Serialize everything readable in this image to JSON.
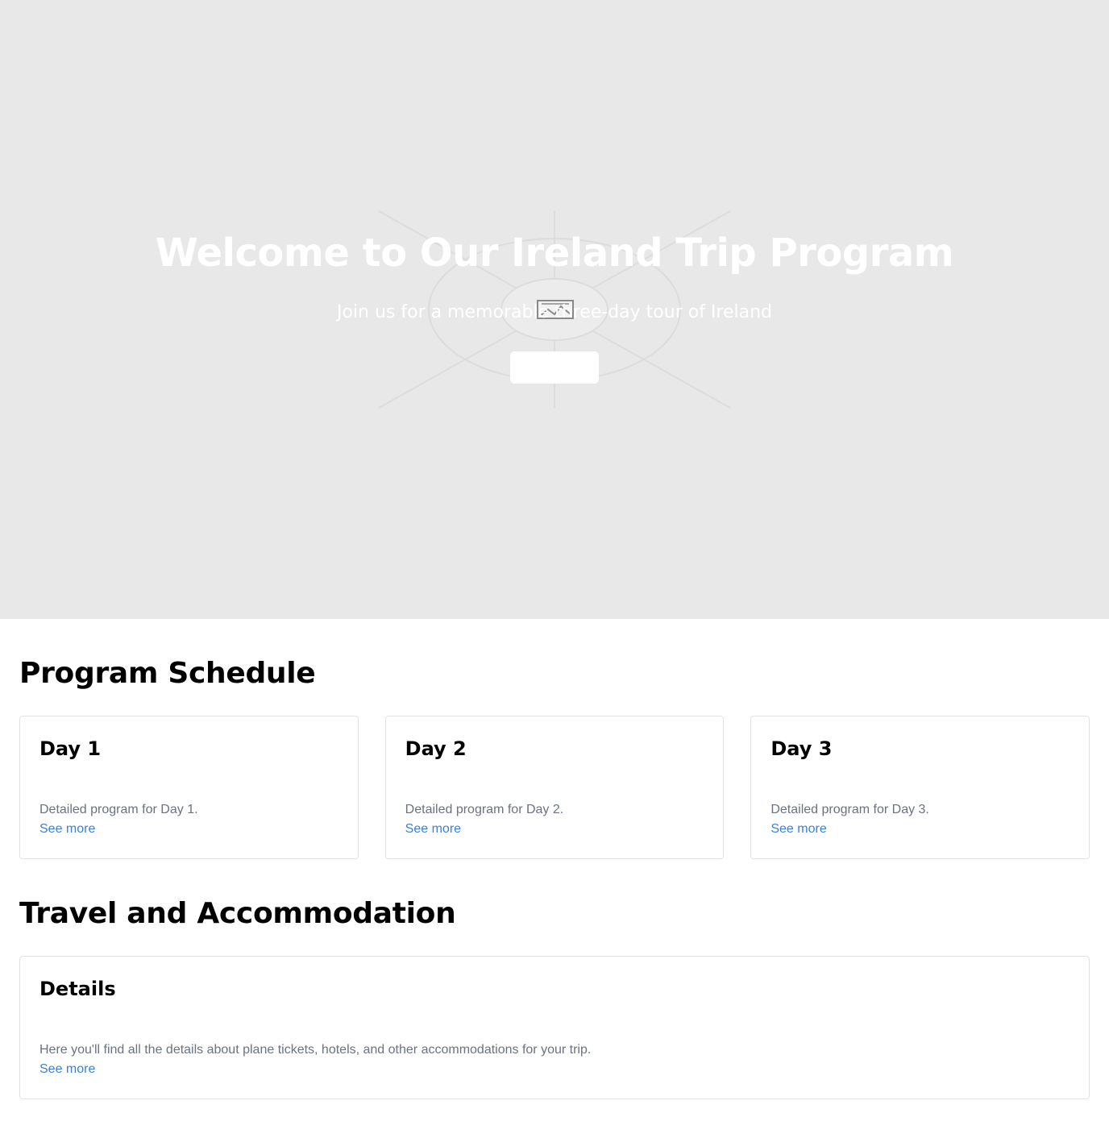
{
  "hero": {
    "title": "Welcome to Our Ireland Trip Program",
    "subtitle": "Join us for a memorable three-day tour of Ireland",
    "button_label": "",
    "background_color": "#e8e8e8",
    "placeholder_icon": "broken-image-icon"
  },
  "schedule": {
    "title": "Program Schedule",
    "days": [
      {
        "title": "Day 1",
        "text": "Detailed program for Day 1.",
        "link": "See more"
      },
      {
        "title": "Day 2",
        "text": "Detailed program for Day 2.",
        "link": "See more"
      },
      {
        "title": "Day 3",
        "text": "Detailed program for Day 3.",
        "link": "See more"
      }
    ]
  },
  "travel": {
    "title": "Travel and Accommodation",
    "card": {
      "title": "Details",
      "text": "Here you'll find all the details about plane tickets, hotels, and other accommodations for your trip.",
      "link": "See more"
    }
  },
  "colors": {
    "link": "#3b82d6",
    "muted_text": "#6b7280",
    "card_border": "#e2e2e2"
  }
}
